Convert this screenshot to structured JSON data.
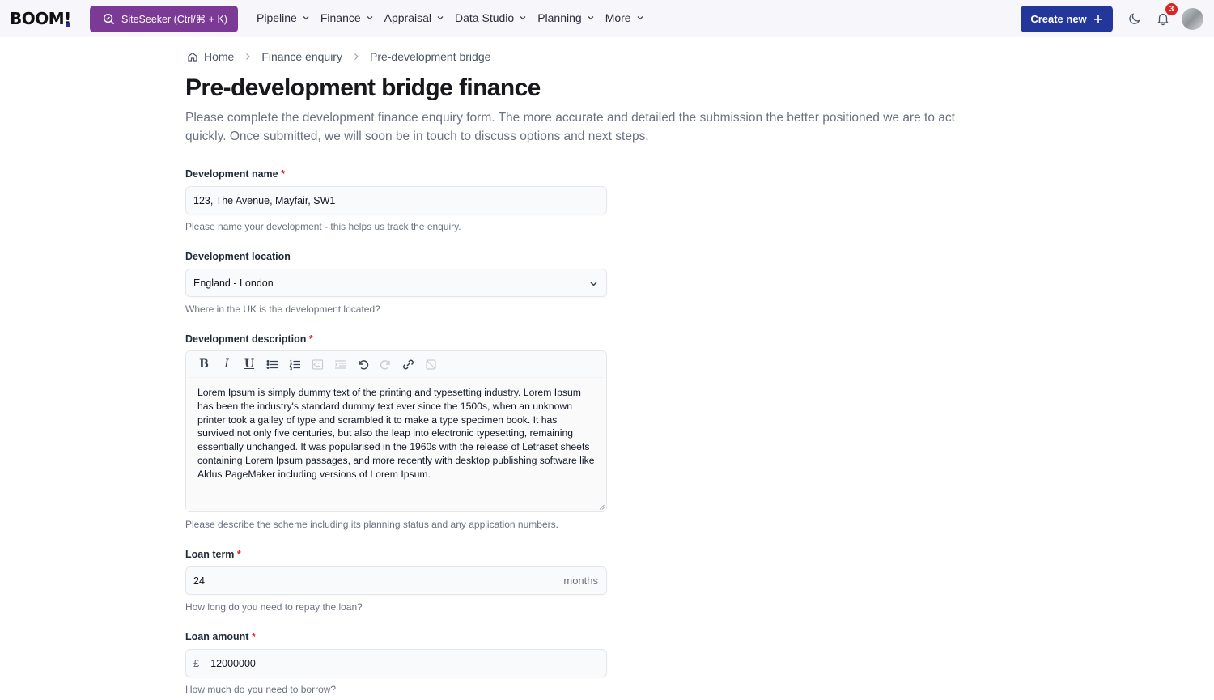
{
  "topbar": {
    "logo": "BOOM",
    "logo_bang": "!",
    "siteseeker_label": "SiteSeeker (Ctrl/⌘ + K)",
    "nav": [
      {
        "label": "Pipeline"
      },
      {
        "label": "Finance"
      },
      {
        "label": "Appraisal"
      },
      {
        "label": "Data Studio"
      },
      {
        "label": "Planning"
      },
      {
        "label": "More"
      }
    ],
    "create_label": "Create new",
    "notification_count": "3",
    "colors": {
      "siteseeker": "#7b3a96",
      "create": "#23379b",
      "badge": "#dc2626"
    }
  },
  "breadcrumb": [
    "Home",
    "Finance enquiry",
    "Pre-development bridge"
  ],
  "page": {
    "title": "Pre-development bridge finance",
    "intro": "Please complete the development finance enquiry form. The more accurate and detailed the submission the better positioned we are to act quickly. Once submitted, we will soon be in touch to discuss options and next steps."
  },
  "form": {
    "dev_name": {
      "label": "Development name",
      "required": "*",
      "value": "123, The Avenue, Mayfair, SW1",
      "hint": "Please name your development - this helps us track the enquiry."
    },
    "dev_location": {
      "label": "Development location",
      "value": "England - London",
      "hint": "Where in the UK is the development located?"
    },
    "dev_description": {
      "label": "Development description",
      "required": "*",
      "toolbar": [
        "bold",
        "italic",
        "underline",
        "bullet-list",
        "numbered-list",
        "outdent",
        "indent",
        "undo",
        "redo",
        "link",
        "unlink"
      ],
      "value": "Lorem Ipsum is simply dummy text of the printing and typesetting industry. Lorem Ipsum has been the industry's standard dummy text ever since the 1500s, when an unknown printer took a galley of type and scrambled it to make a type specimen book. It has survived not only five centuries, but also the leap into electronic typesetting, remaining essentially unchanged. It was popularised in the 1960s with the release of Letraset sheets containing Lorem Ipsum passages, and more recently with desktop publishing software like Aldus PageMaker including versions of Lorem Ipsum.",
      "hint": "Please describe the scheme including its planning status and any application numbers."
    },
    "loan_term": {
      "label": "Loan term",
      "required": "*",
      "value": "24",
      "suffix": "months",
      "hint": "How long do you need to repay the loan?"
    },
    "loan_amount": {
      "label": "Loan amount",
      "required": "*",
      "prefix": "£",
      "value": "12000000",
      "hint": "How much do you need to borrow?"
    }
  }
}
